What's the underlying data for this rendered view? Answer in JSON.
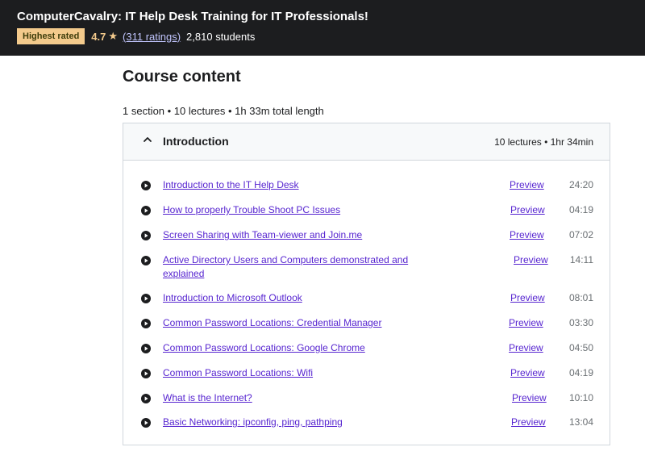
{
  "header": {
    "course_title": "ComputerCavalry: IT Help Desk Training for IT Professionals!",
    "badge": "Highest rated",
    "rating": "4.7",
    "ratings_link": "(311 ratings)",
    "students": "2,810 students"
  },
  "content": {
    "heading": "Course content",
    "summary": "1 section • 10 lectures • 1h 33m total length",
    "section": {
      "title": "Introduction",
      "stats": "10 lectures • 1hr 34min",
      "lectures": [
        {
          "title": "Introduction to the IT Help Desk",
          "preview": "Preview",
          "duration": "24:20"
        },
        {
          "title": "How to properly Trouble Shoot PC Issues",
          "preview": "Preview",
          "duration": "04:19"
        },
        {
          "title": "Screen Sharing with Team-viewer and Join.me",
          "preview": "Preview",
          "duration": "07:02"
        },
        {
          "title": "Active Directory Users and Computers demonstrated and explained",
          "preview": "Preview",
          "duration": "14:11"
        },
        {
          "title": "Introduction to Microsoft Outlook",
          "preview": "Preview",
          "duration": "08:01"
        },
        {
          "title": "Common Password Locations: Credential Manager",
          "preview": "Preview",
          "duration": "03:30"
        },
        {
          "title": "Common Password Locations: Google Chrome",
          "preview": "Preview",
          "duration": "04:50"
        },
        {
          "title": "Common Password Locations: Wifi",
          "preview": "Preview",
          "duration": "04:19"
        },
        {
          "title": "What is the Internet?",
          "preview": "Preview",
          "duration": "10:10"
        },
        {
          "title": "Basic Networking: ipconfig, ping, pathping",
          "preview": "Preview",
          "duration": "13:04"
        }
      ]
    }
  },
  "icons": {
    "star": "star-icon",
    "chevron": "chevron-up-icon",
    "lecture": "play-circle-icon"
  },
  "colors": {
    "header_bg": "#1c1d1f",
    "badge_bg": "#f3ca8c",
    "rating": "#f3ca8c",
    "link": "#5624d0"
  }
}
